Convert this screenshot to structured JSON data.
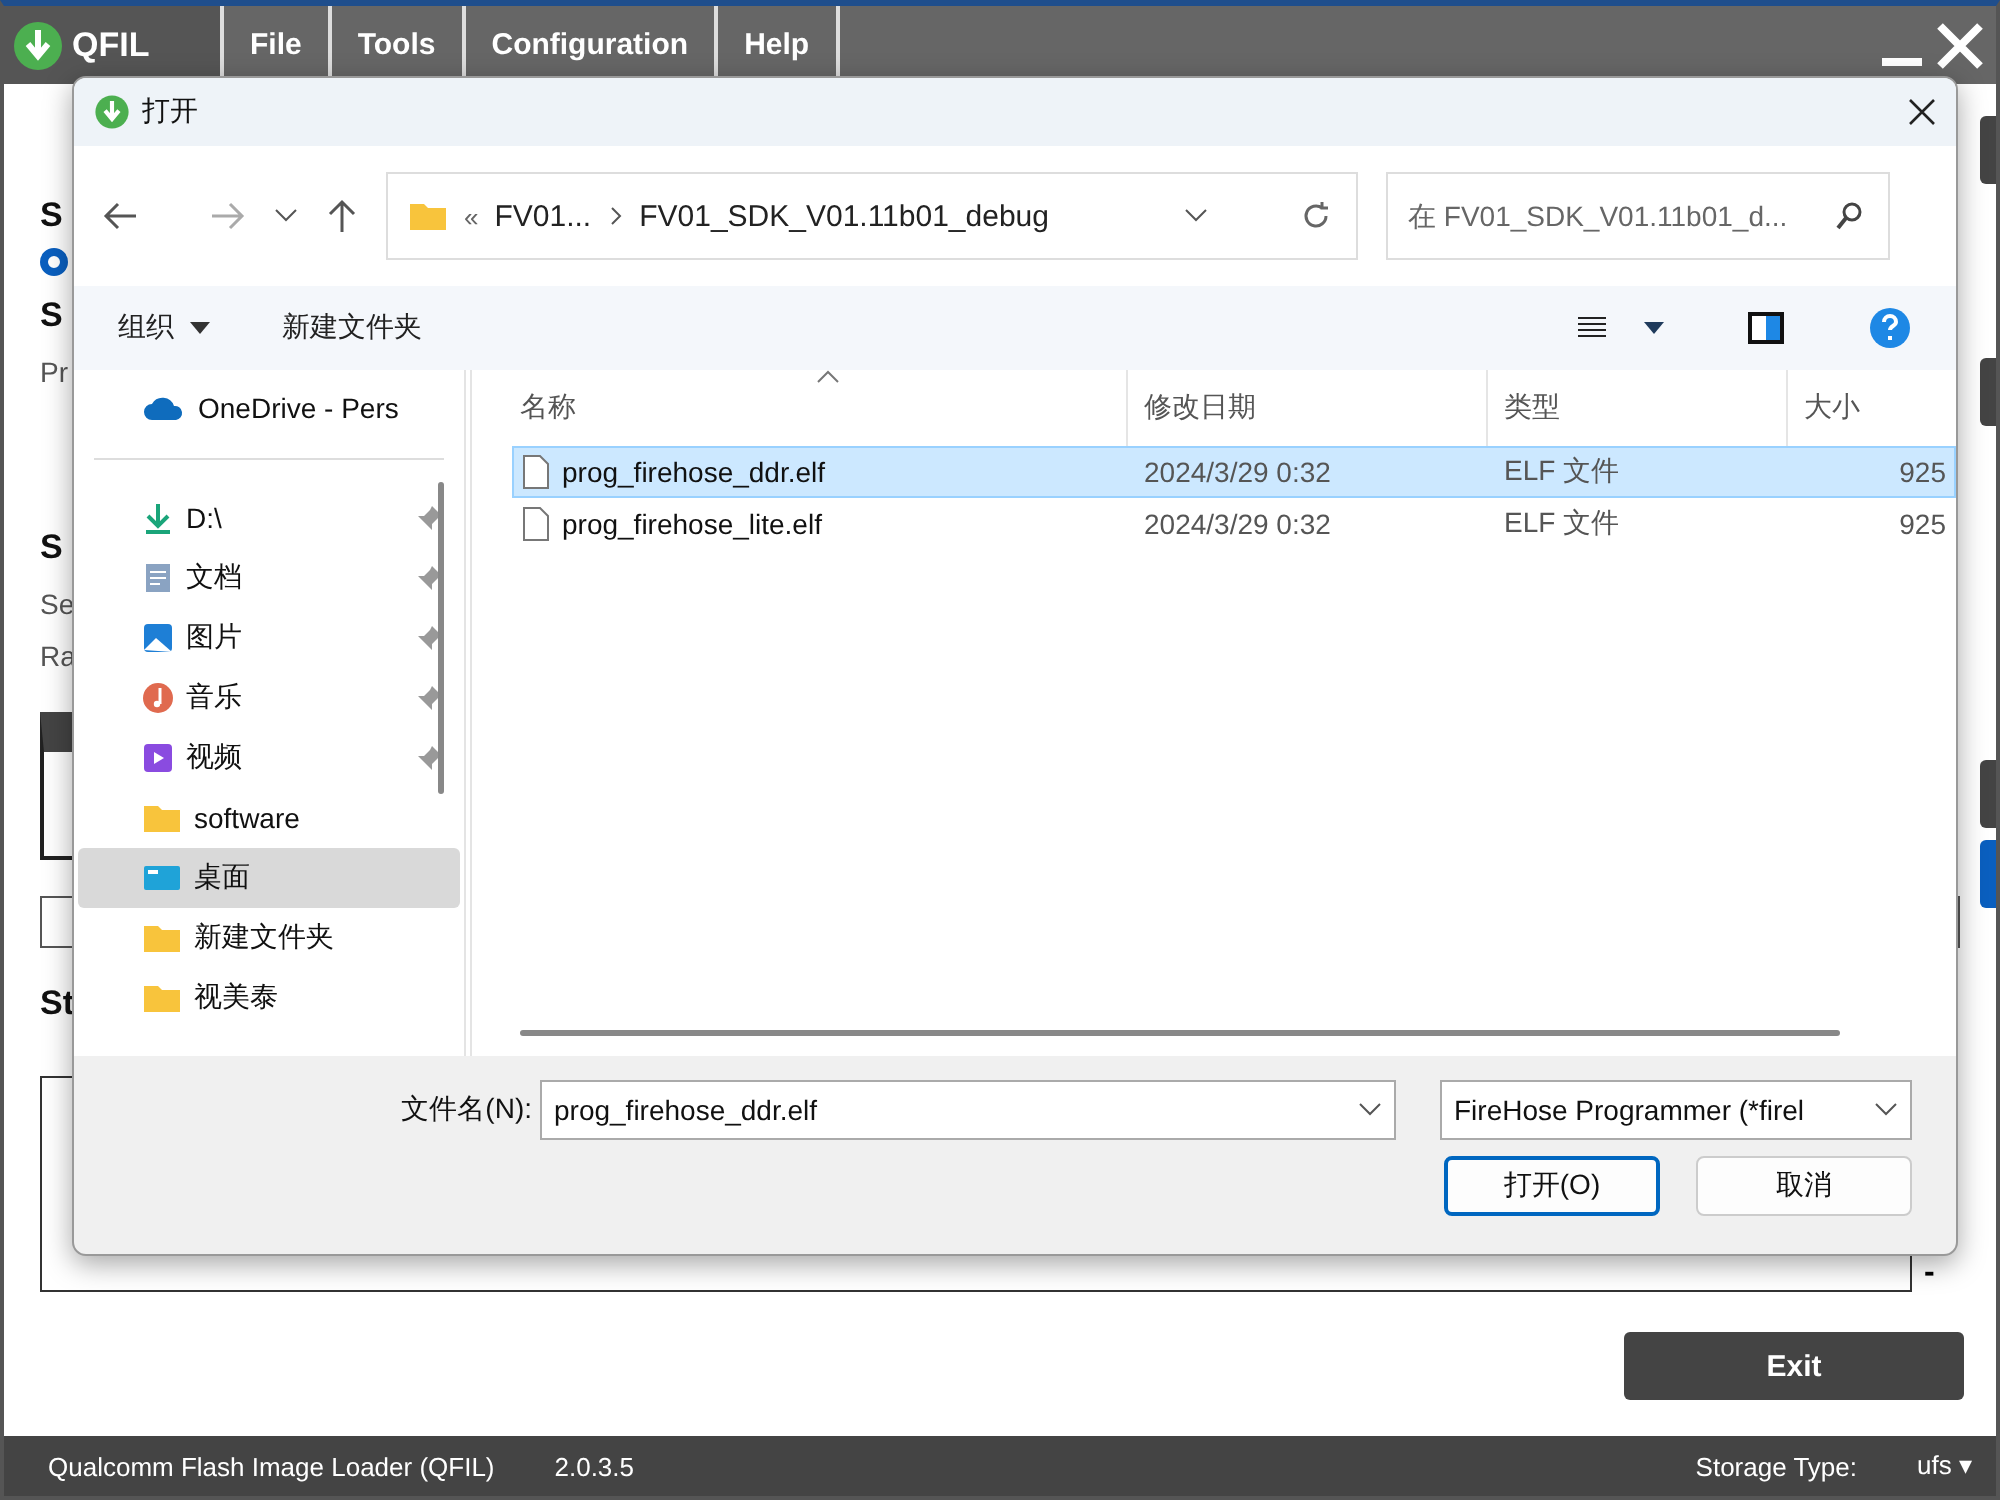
{
  "app": {
    "title": "QFIL",
    "menu": [
      "File",
      "Tools",
      "Configuration",
      "Help"
    ]
  },
  "background": {
    "labels": [
      {
        "kind": "heading",
        "text": "S"
      },
      {
        "kind": "radio",
        "selected": true
      },
      {
        "kind": "heading",
        "text": "S"
      },
      {
        "kind": "text",
        "text": "Pr"
      },
      {
        "kind": "gap"
      },
      {
        "kind": "heading",
        "text": "S"
      },
      {
        "kind": "text",
        "text": "Se"
      },
      {
        "kind": "text",
        "text": "Ra"
      }
    ],
    "status_heading": "St",
    "status_dash": "-",
    "exit_button": "Exit"
  },
  "dialog": {
    "title": "打开",
    "breadcrumb_marker": "«",
    "breadcrumbs": [
      "FV01...",
      "FV01_SDK_V01.11b01_debug"
    ],
    "search": {
      "placeholder": "在 FV01_SDK_V01.11b01_d..."
    },
    "commands": [
      {
        "label": "组织",
        "dropdown": true
      },
      {
        "label": "新建文件夹",
        "dropdown": false
      }
    ],
    "nav": [
      {
        "kind": "cloud",
        "label": "OneDrive - Pers",
        "pinned": false,
        "selected": false
      },
      {
        "kind": "download",
        "label": "D:\\",
        "pinned": true,
        "selected": false
      },
      {
        "kind": "document",
        "label": "文档",
        "pinned": true,
        "selected": false
      },
      {
        "kind": "image",
        "label": "图片",
        "pinned": true,
        "selected": false
      },
      {
        "kind": "music",
        "label": "音乐",
        "pinned": true,
        "selected": false
      },
      {
        "kind": "video",
        "label": "视频",
        "pinned": true,
        "selected": false
      },
      {
        "kind": "folder",
        "label": "software",
        "pinned": false,
        "selected": false
      },
      {
        "kind": "desktop",
        "label": "桌面",
        "pinned": false,
        "selected": true
      },
      {
        "kind": "folder",
        "label": "新建文件夹",
        "pinned": false,
        "selected": false
      },
      {
        "kind": "folder",
        "label": "视美泰",
        "pinned": false,
        "selected": false
      }
    ],
    "columns": [
      "名称",
      "修改日期",
      "类型",
      "大小"
    ],
    "rows": [
      {
        "name": "prog_firehose_ddr.elf",
        "modified": "2024/3/29 0:32",
        "type": "ELF 文件",
        "size": "925",
        "selected": true
      },
      {
        "name": "prog_firehose_lite.elf",
        "modified": "2024/3/29 0:32",
        "type": "ELF 文件",
        "size": "925",
        "selected": false
      }
    ],
    "filename_label": "文件名(N):",
    "filename": "prog_firehose_ddr.elf",
    "filter": "FireHose Programmer (*firel",
    "buttons": [
      {
        "label": "打开(O)",
        "focused": true
      },
      {
        "label": "取消",
        "focused": false
      }
    ]
  },
  "status_bar": {
    "app_name": "Qualcomm Flash Image Loader (QFIL)",
    "version": "2.0.3.5",
    "storage_label": "Storage Type:",
    "storage_value": "ufs",
    "storage_caret": "▾"
  }
}
